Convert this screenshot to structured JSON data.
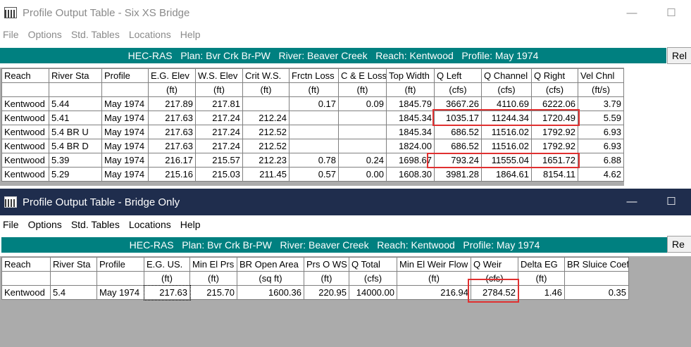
{
  "window1": {
    "title": "Profile Output Table - Six XS Bridge",
    "controls": {
      "minimize": "—",
      "maximize": "☐"
    },
    "menu": [
      "File",
      "Options",
      "Std. Tables",
      "Locations",
      "Help"
    ],
    "banner": "HEC-RAS   Plan: Bvr Crk Br-PW   River: Beaver Creek   Reach: Kentwood   Profile: May 1974",
    "reload_label": "Rel",
    "headers": [
      "Reach",
      "River Sta",
      "Profile",
      "E.G. Elev",
      "W.S. Elev",
      "Crit W.S.",
      "Frctn Loss",
      "C & E Loss",
      "Top Width",
      "Q Left",
      "Q Channel",
      "Q Right",
      "Vel Chnl"
    ],
    "units": [
      "",
      "",
      "",
      "(ft)",
      "(ft)",
      "(ft)",
      "(ft)",
      "(ft)",
      "(ft)",
      "(cfs)",
      "(cfs)",
      "(cfs)",
      "(ft/s)"
    ],
    "rows": [
      [
        "Kentwood",
        "5.44",
        "May 1974",
        "217.89",
        "217.81",
        "",
        "0.17",
        "0.09",
        "1845.79",
        "3667.26",
        "4110.69",
        "6222.06",
        "3.79"
      ],
      [
        "Kentwood",
        "5.41",
        "May 1974",
        "217.63",
        "217.24",
        "212.24",
        "",
        "",
        "1845.34",
        "1035.17",
        "11244.34",
        "1720.49",
        "5.59"
      ],
      [
        "Kentwood",
        "5.4    BR U",
        "May 1974",
        "217.63",
        "217.24",
        "212.52",
        "",
        "",
        "1845.34",
        "686.52",
        "11516.02",
        "1792.92",
        "6.93"
      ],
      [
        "Kentwood",
        "5.4    BR D",
        "May 1974",
        "217.63",
        "217.24",
        "212.52",
        "",
        "",
        "1824.00",
        "686.52",
        "11516.02",
        "1792.92",
        "6.93"
      ],
      [
        "Kentwood",
        "5.39",
        "May 1974",
        "216.17",
        "215.57",
        "212.23",
        "0.78",
        "0.24",
        "1698.67",
        "793.24",
        "11555.04",
        "1651.72",
        "6.88"
      ],
      [
        "Kentwood",
        "5.29",
        "May 1974",
        "215.16",
        "215.03",
        "211.45",
        "0.57",
        "0.00",
        "1608.30",
        "3981.28",
        "1864.61",
        "8154.11",
        "4.62"
      ]
    ]
  },
  "window2": {
    "title": "Profile Output Table - Bridge Only",
    "controls": {
      "minimize": "—",
      "maximize": "☐"
    },
    "menu": [
      "File",
      "Options",
      "Std. Tables",
      "Locations",
      "Help"
    ],
    "banner": "HEC-RAS   Plan: Bvr Crk Br-PW   River: Beaver Creek   Reach: Kentwood   Profile: May 1974",
    "reload_label": "Re",
    "headers": [
      "Reach",
      "River Sta",
      "Profile",
      "E.G. US.",
      "Min El Prs",
      "BR Open Area",
      "Prs O WS",
      "Q Total",
      "Min El Weir Flow",
      "Q Weir",
      "Delta EG",
      "BR Sluice Coef"
    ],
    "units": [
      "",
      "",
      "",
      "(ft)",
      "(ft)",
      "(sq ft)",
      "(ft)",
      "(cfs)",
      "(ft)",
      "(cfs)",
      "(ft)",
      ""
    ],
    "rows": [
      [
        "Kentwood",
        "5.4",
        "May 1974",
        "217.63",
        "215.70",
        "1600.36",
        "220.95",
        "14000.00",
        "216.94",
        "2784.52",
        "1.46",
        "0.35"
      ]
    ]
  },
  "colors": {
    "banner_bg": "#008080",
    "highlight": "#e03030",
    "title2_bg": "#1f2d4d"
  }
}
